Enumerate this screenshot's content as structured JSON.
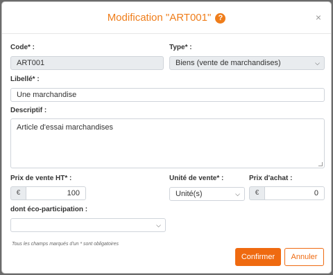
{
  "modal": {
    "title": "Modification \"ART001\"",
    "help_icon": "?",
    "close_icon": "×"
  },
  "form": {
    "code": {
      "label": "Code* :",
      "value": "ART001"
    },
    "type": {
      "label": "Type* :",
      "value": "Biens (vente de marchandises)"
    },
    "libelle": {
      "label": "Libellé* :",
      "value": "Une marchandise"
    },
    "descriptif": {
      "label": "Descriptif :",
      "value": "Article d'essai marchandises"
    },
    "prix_vente": {
      "label": "Prix de vente HT* :",
      "currency": "€",
      "value": "100"
    },
    "unite_vente": {
      "label": "Unité de vente* :",
      "value": "Unité(s)"
    },
    "prix_achat": {
      "label": "Prix d'achat :",
      "currency": "€",
      "value": "0"
    },
    "eco_participation": {
      "label": "dont éco-participation :",
      "value": ""
    }
  },
  "note": "Tous les champs marqués d'un * sont obligatoires",
  "buttons": {
    "confirm": "Confirmer",
    "cancel": "Annuler"
  },
  "colors": {
    "accent": "#ef6a10",
    "title": "#ef7d1a",
    "disabled_bg": "#e9ecef"
  },
  "icons": {
    "help": "question-circle-icon",
    "close": "close-icon",
    "select": "chevron-down-icon",
    "currency": "euro-icon"
  }
}
